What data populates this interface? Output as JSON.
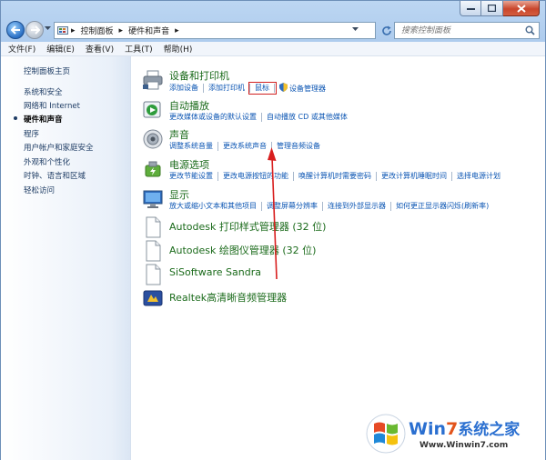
{
  "window": {
    "breadcrumb": [
      "控制面板",
      "硬件和声音"
    ],
    "search_placeholder": "搜索控制面板"
  },
  "menubar": [
    "文件(F)",
    "编辑(E)",
    "查看(V)",
    "工具(T)",
    "帮助(H)"
  ],
  "sidebar": {
    "items": [
      {
        "label": "控制面板主页"
      },
      {
        "label": "系统和安全"
      },
      {
        "label": "网络和 Internet"
      },
      {
        "label": "硬件和声音",
        "active": true
      },
      {
        "label": "程序"
      },
      {
        "label": "用户帐户和家庭安全"
      },
      {
        "label": "外观和个性化"
      },
      {
        "label": "时钟、语言和区域"
      },
      {
        "label": "轻松访问"
      }
    ]
  },
  "categories": [
    {
      "title": "设备和打印机",
      "icon": "printer-icon",
      "links": [
        "添加设备",
        "添加打印机",
        "鼠标",
        "设备管理器"
      ]
    },
    {
      "title": "自动播放",
      "icon": "autoplay-icon",
      "links": [
        "更改媒体或设备的默认设置",
        "自动播放 CD 或其他媒体"
      ]
    },
    {
      "title": "声音",
      "icon": "speaker-icon",
      "links": [
        "调整系统音量",
        "更改系统声音",
        "管理音频设备"
      ]
    },
    {
      "title": "电源选项",
      "icon": "power-icon",
      "links": [
        "更改节能设置",
        "更改电源按钮的功能",
        "唤醒计算机时需要密码",
        "更改计算机睡眠时间",
        "选择电源计划"
      ]
    },
    {
      "title": "显示",
      "icon": "display-icon",
      "links": [
        "放大或缩小文本和其他项目",
        "调整屏幕分辨率",
        "连接到外部显示器",
        "如何更正显示器闪烁(刷新率)"
      ]
    }
  ],
  "programs": [
    {
      "title": "Autodesk 打印样式管理器 (32 位)",
      "icon": "file-icon"
    },
    {
      "title": "Autodesk 绘图仪管理器 (32 位)",
      "icon": "file-icon"
    },
    {
      "title": "SiSoftware Sandra",
      "icon": "file-icon"
    },
    {
      "title": "Realtek高清晰音频管理器",
      "icon": "realtek-icon"
    }
  ],
  "watermark": {
    "brand_a": "Win",
    "brand_b": "7",
    "brand_c": "系统之家",
    "url": "Www.Winwin7.com"
  },
  "colors": {
    "link": "#0b55b3",
    "category_title": "#1a6a1a",
    "highlight": "#d02020"
  }
}
